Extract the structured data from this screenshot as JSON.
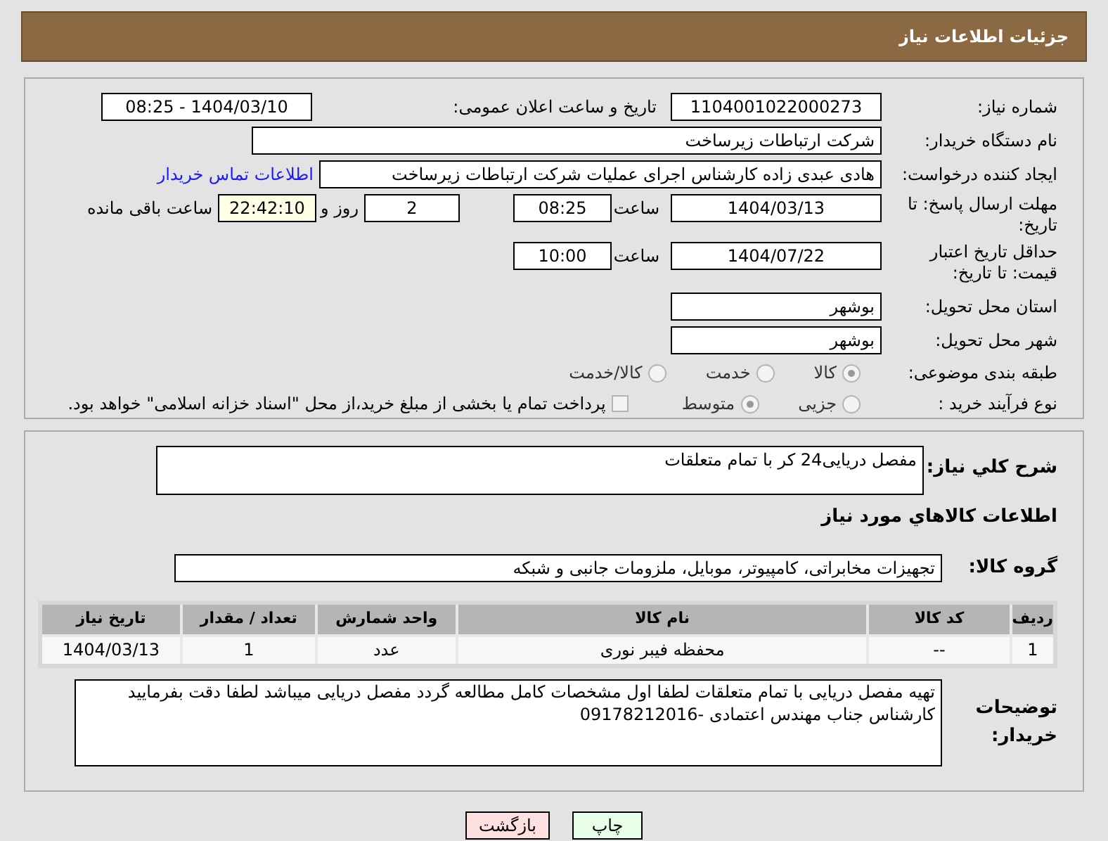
{
  "header": {
    "title": "جزئیات اطلاعات نیاز"
  },
  "need_number": {
    "label": "شماره نیاز:",
    "value": "1104001022000273"
  },
  "announce": {
    "label": "تاریخ و ساعت اعلان عمومی:",
    "value": "1404/03/10 - 08:25"
  },
  "buyer_org": {
    "label": "نام دستگاه خریدار:",
    "value": "شرکت ارتباطات زیرساخت"
  },
  "requester": {
    "label": "ایجاد کننده درخواست:",
    "value": "هادی عبدی زاده کارشناس اجرای عملیات شرکت ارتباطات زیرساخت",
    "link": "اطلاعات تماس خریدار"
  },
  "deadline": {
    "label": "مهلت ارسال پاسخ: تا تاریخ:",
    "date": "1404/03/13",
    "time_label": "ساعت",
    "time": "08:25",
    "days": "2",
    "days_label": "روز و",
    "remaining": "22:42:10",
    "remaining_label": "ساعت باقی مانده"
  },
  "validity": {
    "label": "حداقل تاریخ اعتبار قیمت: تا تاریخ:",
    "date": "1404/07/22",
    "time_label": "ساعت",
    "time": "10:00"
  },
  "province": {
    "label": "استان محل تحویل:",
    "value": "بوشهر"
  },
  "city": {
    "label": "شهر محل تحویل:",
    "value": "بوشهر"
  },
  "category": {
    "label": "طبقه بندی موضوعی:",
    "options": [
      {
        "label": "کالا",
        "selected": true
      },
      {
        "label": "خدمت",
        "selected": false
      },
      {
        "label": "کالا/خدمت",
        "selected": false
      }
    ]
  },
  "process": {
    "label": "نوع فرآیند خرید :",
    "options": [
      {
        "label": "جزیی",
        "selected": false
      },
      {
        "label": "متوسط",
        "selected": true
      }
    ],
    "payment": {
      "label": "پرداخت تمام یا بخشی از مبلغ خرید،از محل \"اسناد خزانه اسلامی\" خواهد بود.",
      "checked": false
    }
  },
  "description": {
    "label": "شرح کلي نياز:",
    "value": "مفصل دریایی24 کر  با تمام متعلقات"
  },
  "goods_title": "اطلاعات کالاهاي مورد نياز",
  "goods_group": {
    "label": "گروه کالا:",
    "value": "تجهیزات مخابراتی، کامپیوتر، موبایل، ملزومات جانبی و شبکه"
  },
  "table": {
    "columns": [
      "ردیف",
      "کد کالا",
      "نام کالا",
      "واحد شمارش",
      "تعداد / مقدار",
      "تاریخ نیاز"
    ],
    "rows": [
      [
        "1",
        "--",
        "محفظه فیبر نوری",
        "عدد",
        "1",
        "1404/03/13"
      ]
    ]
  },
  "buyer_notes": {
    "label": "توضیحات خریدار:",
    "value": "تهیه مفصل دریایی با تمام متعلقات لطفا اول مشخصات کامل مطالعه گردد مفصل دریایی میباشد لطفا دقت بفرمایید کارشناس جناب مهندس اعتمادی -09178212016"
  },
  "buttons": [
    {
      "label": "چاپ",
      "kind": "print"
    },
    {
      "label": "بازگشت",
      "kind": "back"
    }
  ]
}
